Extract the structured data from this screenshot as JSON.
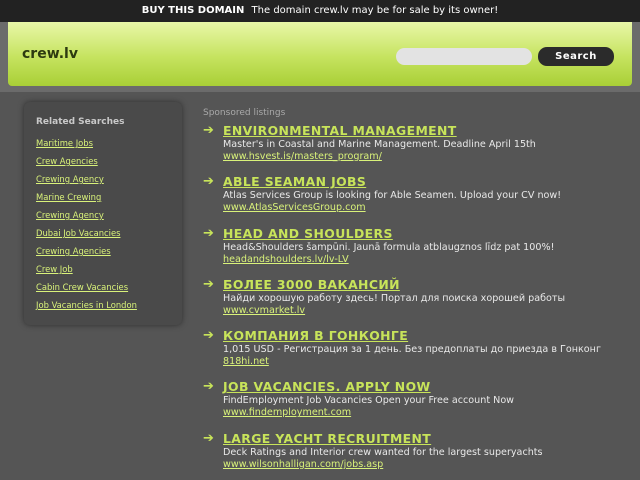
{
  "topbar": {
    "buy_label": "BUY THIS DOMAIN",
    "message": "The domain crew.lv may be for sale by its owner!"
  },
  "header": {
    "logo": "crew.lv",
    "search_placeholder": "",
    "search_button": "Search"
  },
  "related": {
    "title": "Related Searches",
    "items": [
      "Maritime Jobs",
      "Crew Agencies",
      "Crewing Agency",
      "Marine Crewing",
      "Crewing Agency",
      "Dubai Job Vacancies",
      "Crewing Agencies",
      "Crew Job",
      "Cabin Crew Vacancies",
      "Job Vacancies in London"
    ]
  },
  "sponsored": {
    "label": "Sponsored listings",
    "listings": [
      {
        "title": "ENVIRONMENTAL MANAGEMENT",
        "desc": "Master's in Coastal and Marine Management. Deadline April 15th",
        "url": "www.hsvest.is/masters_program/"
      },
      {
        "title": "ABLE SEAMAN JOBS",
        "desc": "Atlas Services Group is looking for Able Seamen. Upload your CV now!",
        "url": "www.AtlasServicesGroup.com"
      },
      {
        "title": "HEAD AND SHOULDERS",
        "desc": "Head&Shoulders šampūni. Jaunā formula atblaugznos līdz pat 100%!",
        "url": "headandshoulders.lv/lv-LV"
      },
      {
        "title": "БОЛЕЕ 3000 ВАКАНСИЙ",
        "desc": "Найди хорошую работу здесь! Портал для поиска хорошей работы",
        "url": "www.cvmarket.lv"
      },
      {
        "title": "КОМПАНИЯ В ГОНКОНГЕ",
        "desc": "1,015 USD - Регистрация за 1 день. Без предоплаты до приезда в Гонконг",
        "url": "818hi.net"
      },
      {
        "title": "JOB VACANCIES. APPLY NOW",
        "desc": "FindEmployment Job Vacancies Open your Free account Now",
        "url": "www.findemployment.com"
      },
      {
        "title": "LARGE YACHT RECRUITMENT",
        "desc": "Deck Ratings and Interior crew wanted for the largest superyachts",
        "url": "www.wilsonhalligan.com/jobs.asp"
      }
    ]
  },
  "colors": {
    "background": "#555555",
    "topbar": "#222222",
    "accent_green": "#c8e45a",
    "link_green": "#d9f27a",
    "header_gradient_top": "#e9f7a8",
    "header_gradient_bottom": "#a9cf36"
  },
  "icons": {
    "listing_bullet": "arrow-right-icon"
  }
}
